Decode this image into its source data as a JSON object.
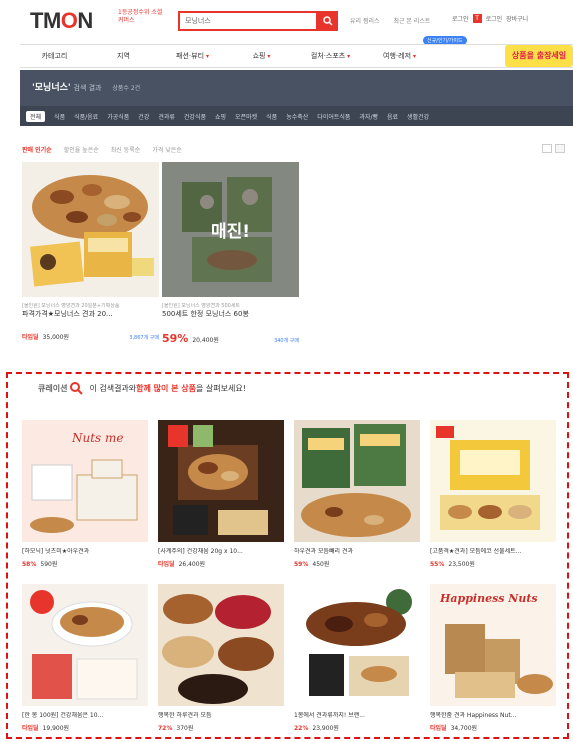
{
  "header": {
    "logo": "TMON",
    "logo_sub": "1등공정수위 소셜커머스",
    "search_value": "모닝너스",
    "top_links": [
      "유리 찜리스",
      "최근 본 리스트"
    ],
    "user_links": [
      "로그인",
      "T",
      "로그인",
      "장바구니"
    ]
  },
  "nav": {
    "items": [
      "카테고리",
      "지역",
      "패션·뷰티",
      "쇼핑",
      "컬처·스포츠",
      "여행·레저"
    ],
    "badge": "신규/인기/가이드",
    "sale_tag": "",
    "sale_label": "상품을 출장세일"
  },
  "result_bar": {
    "query": "'모닝너스'",
    "suffix": "검색 결과",
    "count": "상품수 2건"
  },
  "filters": [
    "전체",
    "식품",
    "식품/음료",
    "가공식품",
    "건강",
    "견과류",
    "건강식품",
    "쇼핑",
    "오픈마켓",
    "식품",
    "농수축산",
    "다이어트식품",
    "과자/빵",
    "음료",
    "생활건강"
  ],
  "sort": {
    "tabs": [
      "판매 인기순",
      "할인율 높은순",
      "최신 등록순",
      "가격 낮은순"
    ],
    "active": 0
  },
  "results": [
    {
      "sub": "[올인원] 모닝너스 영양견과 20일분+기획상품",
      "title": "파격가격★모닝너스 견과 20...",
      "discount": "타임딜",
      "price": "35,000원",
      "sold": "3,867개 구매"
    },
    {
      "sub": "[올인원] 모닝너스 영양견과 500세트",
      "title": "500세트 한정 모닝너스 60봉",
      "discount": "59%",
      "price": "20,400원",
      "sold": "340개 구매",
      "overlay": "매진!"
    }
  ],
  "recommendations": {
    "logo": "큐레이션",
    "header_pre": "이 검색결과와 ",
    "header_hl": "함께 많이 본 상품",
    "header_post": "을 살펴보세요!",
    "items": [
      {
        "title": "[하모닉] 넛츠미★아우견과",
        "discount": "58%",
        "price": "590원"
      },
      {
        "title": "[사계주의] 건강채움 20g x 10...",
        "discount": "타임딜",
        "price": "26,400원"
      },
      {
        "title": "하우견과 모듬빼리 견과",
        "discount": "59%",
        "price": "450원"
      },
      {
        "title": "[고품격★견과] 모듬에코 선물세트...",
        "discount": "55%",
        "price": "23,500원"
      },
      {
        "title": "[한 봉 100원] 건강채움은 10...",
        "discount": "타임딜",
        "price": "19,900원"
      },
      {
        "title": "행복한 하루견과 모듬",
        "discount": "72%",
        "price": "370원"
      },
      {
        "title": "1봉에서 견과류까지! 브랜...",
        "discount": "22%",
        "price": "23,900원"
      },
      {
        "title": "행복한줌 견과 Happiness Nut...",
        "discount": "타임딜",
        "price": "34,700원"
      }
    ]
  },
  "colors": {
    "accent": "#e8352b",
    "dark_bar": "#495262",
    "link_blue": "#3b82f6"
  }
}
